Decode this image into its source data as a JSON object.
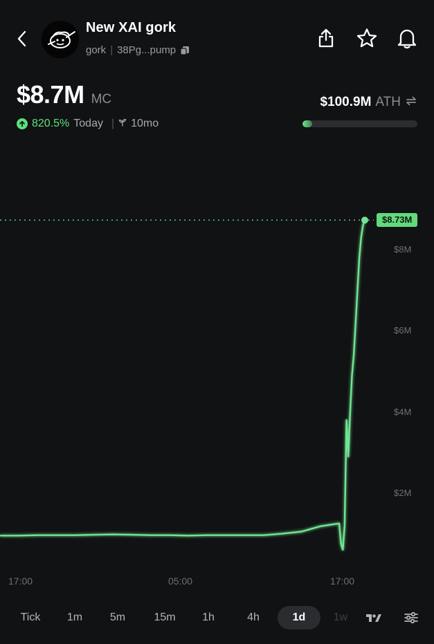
{
  "header": {
    "token_name": "New XAI gork",
    "ticker": "gork",
    "address": "38Pg...pump",
    "back_icon": "chevron-left-icon",
    "share_icon": "share-icon",
    "star_icon": "star-icon",
    "bell_icon": "bell-icon",
    "copy_icon": "copy-icon"
  },
  "market": {
    "market_cap": "$8.7M",
    "market_cap_label": "MC",
    "change_pct": "820.5%",
    "change_period": "Today",
    "age": "10mo",
    "ath_value": "$100.9M",
    "ath_label": "ATH",
    "ath_progress": 0.086,
    "accent_color": "#5ee07c"
  },
  "chart_data": {
    "type": "line",
    "current_price_label": "$8.73M",
    "y_tick_labels": [
      "$8M",
      "$6M",
      "$4M",
      "$2M"
    ],
    "x_tick_labels": [
      "17:00",
      "05:00",
      "17:00"
    ],
    "ylim": [
      0,
      9.4
    ],
    "series": [
      {
        "x": [
          0,
          1,
          2,
          3,
          4,
          5,
          6,
          7,
          8,
          9,
          10,
          11,
          12,
          13,
          14,
          15,
          16,
          17,
          18,
          19,
          20,
          21,
          22,
          23,
          24,
          25,
          26,
          27,
          28,
          29,
          30,
          31,
          32
        ],
        "values": [
          0.95,
          0.95,
          0.96,
          0.96,
          0.96,
          0.97,
          0.98,
          0.97,
          0.96,
          0.96,
          0.95,
          0.96,
          0.96,
          0.96,
          0.96,
          1.0,
          1.05,
          1.18,
          1.25,
          0.75,
          0.6,
          1.2,
          3.8,
          2.9,
          4.0,
          4.9,
          5.4,
          6.2,
          7.0,
          7.8,
          8.3,
          8.6,
          8.73
        ]
      }
    ],
    "line_color": "#6fe591",
    "grid": false
  },
  "timeframes": {
    "items": [
      "Tick",
      "1m",
      "5m",
      "15m",
      "1h",
      "4h",
      "1d",
      "1w"
    ],
    "active": "1d",
    "tradingview_icon": "tradingview-icon",
    "settings_icon": "sliders-icon"
  }
}
